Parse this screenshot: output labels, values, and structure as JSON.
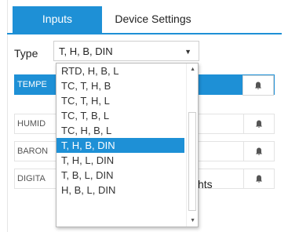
{
  "tabs": {
    "inputs": "Inputs",
    "device_settings": "Device Settings"
  },
  "type_field": {
    "label": "Type",
    "value": "T, H, B, DIN"
  },
  "rows": [
    {
      "label": "TEMPE",
      "active": true
    },
    {
      "label": "HUMID",
      "active": false
    },
    {
      "label": "BARON",
      "active": false
    },
    {
      "label": "DIGITA",
      "active": false,
      "suffix": "hts"
    }
  ],
  "dropdown": {
    "options": [
      "RTD, H, B, L",
      "TC, T, H, B",
      "TC, T, H, L",
      "TC, T, B, L",
      "TC, H, B, L",
      "T, H, B, DIN",
      "T, H, L, DIN",
      "T, B, L, DIN",
      "H, B, L, DIN"
    ],
    "selected_index": 5
  },
  "colors": {
    "accent": "#1e90d6",
    "bell": "#555555"
  },
  "icons": [
    "bell-icon",
    "caret-down-icon",
    "scroll-up-icon",
    "scroll-down-icon"
  ]
}
